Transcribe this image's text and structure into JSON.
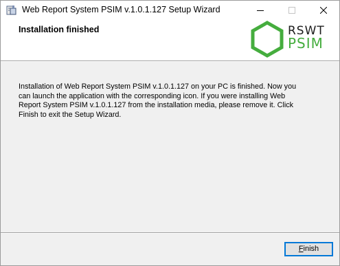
{
  "window": {
    "title": "Web Report System PSIM v.1.0.1.127 Setup Wizard",
    "icons": [
      "installer-app-icon",
      "minimize-icon",
      "maximize-icon",
      "close-icon"
    ]
  },
  "header": {
    "title": "Installation finished",
    "logo": {
      "line1": "RSWT",
      "line2": "PSIM",
      "accent_color": "#45ad3e",
      "text_color": "#1c1c1c"
    }
  },
  "body": {
    "message": "Installation of Web Report System PSIM v.1.0.1.127 on your PC is finished. Now you can launch the application with the corresponding icon. If you were installing Web Report System PSIM v.1.0.1.127 from the installation media, please remove it. Click Finish to exit the Setup Wizard."
  },
  "footer": {
    "finish_accel": "F",
    "finish_rest": "inish",
    "button_border_color": "#0078d7"
  }
}
